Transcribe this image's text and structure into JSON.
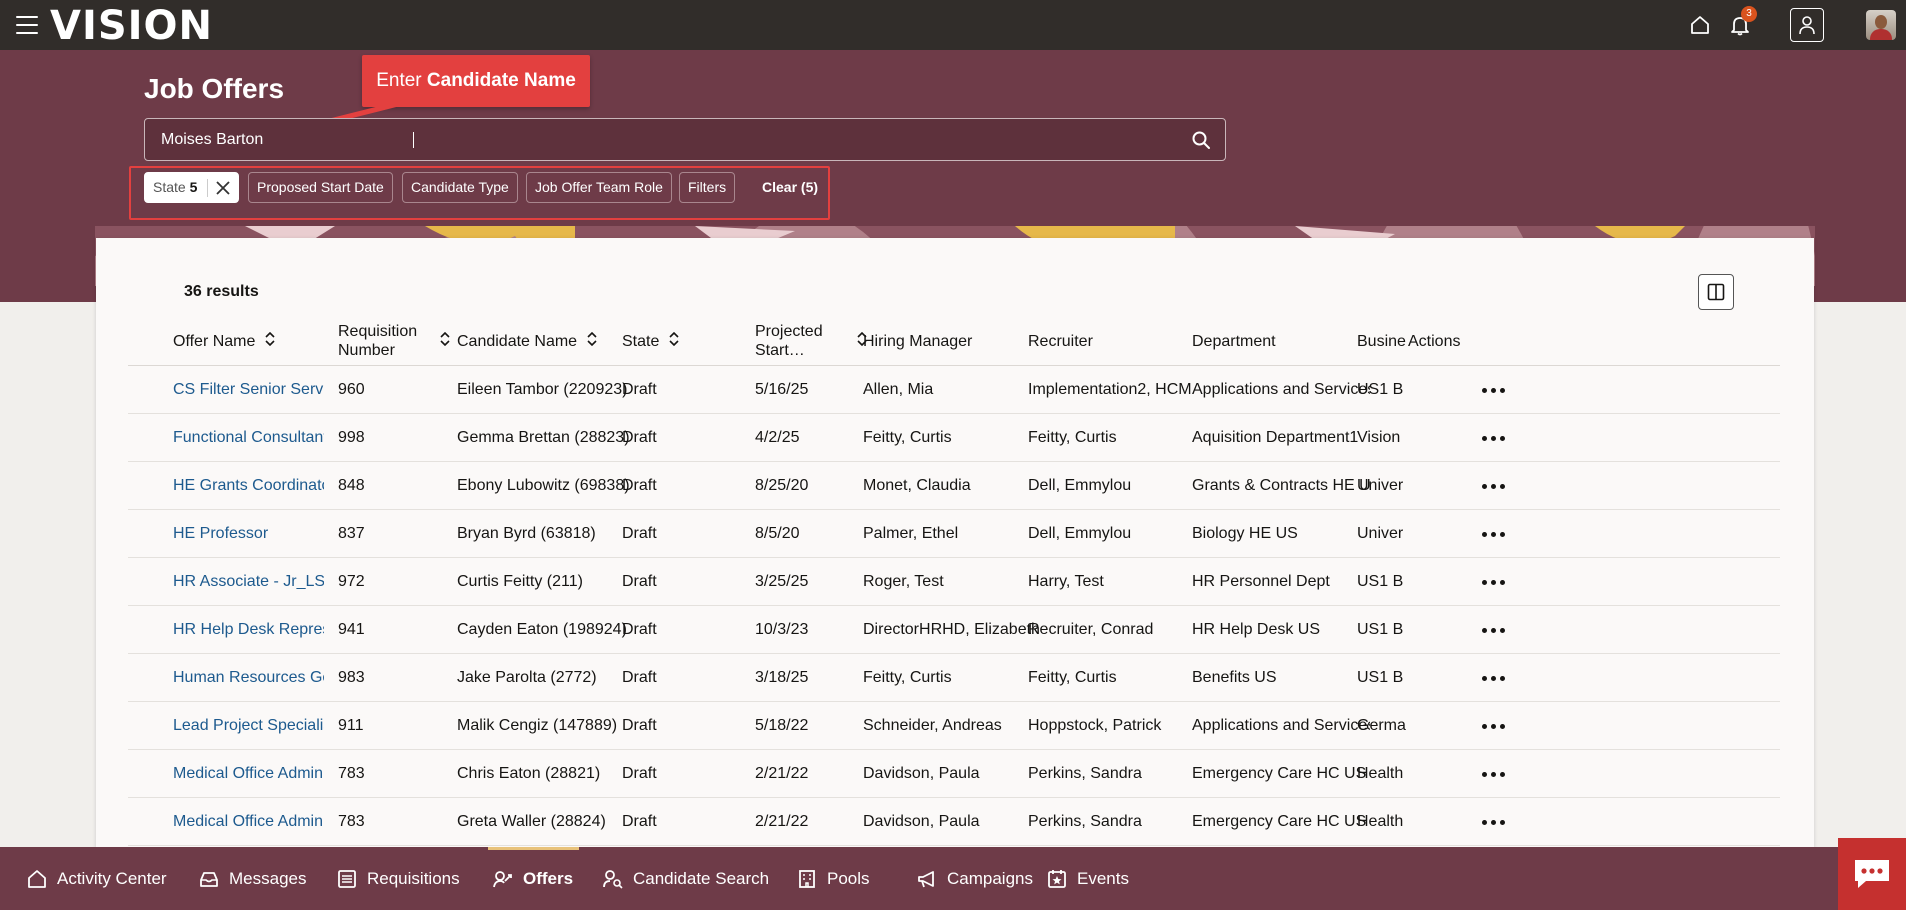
{
  "app": {
    "logo": "VISION",
    "notification_count": "3"
  },
  "page": {
    "title": "Job Offers"
  },
  "callout": {
    "prefix": "Enter ",
    "emphasis": "Candidate Name"
  },
  "search": {
    "value": "Moises Barton"
  },
  "filters": {
    "state_label": "State",
    "state_count": "5",
    "chips": [
      "Proposed Start Date",
      "Candidate Type",
      "Job Offer Team Role",
      "Filters"
    ],
    "clear_label": "Clear (5)"
  },
  "results": {
    "count_label": "36 results"
  },
  "table": {
    "columns": [
      "Offer Name",
      "Requisition Number",
      "Candidate Name",
      "State",
      "Projected Start…",
      "Hiring Manager",
      "Recruiter",
      "Department",
      "Busine",
      "Actions"
    ],
    "rows": [
      [
        "CS Filter Senior Service De",
        "960",
        "Eileen Tambor (220923)",
        "Draft",
        "5/16/25",
        "Allen, Mia",
        "Implementation2, HCM",
        "Applications and Services",
        "US1 B"
      ],
      [
        "Functional Consultant_Lc",
        "998",
        "Gemma Brettan (28823)",
        "Draft",
        "4/2/25",
        "Feitty, Curtis",
        "Feitty, Curtis",
        "Aquisition Department1",
        "Vision"
      ],
      [
        "HE Grants Coordinator",
        "848",
        "Ebony Lubowitz (69838)",
        "Draft",
        "8/25/20",
        "Monet, Claudia",
        "Dell, Emmylou",
        "Grants & Contracts HE US",
        "Univer"
      ],
      [
        "HE Professor",
        "837",
        "Bryan Byrd (63818)",
        "Draft",
        "8/5/20",
        "Palmer, Ethel",
        "Dell, Emmylou",
        "Biology HE US",
        "Univer"
      ],
      [
        "HR Associate - Jr_LS",
        "972",
        "Curtis Feitty (211)",
        "Draft",
        "3/25/25",
        "Roger, Test",
        "Harry, Test",
        "HR Personnel Dept",
        "US1 B"
      ],
      [
        "HR Help Desk Representa",
        "941",
        "Cayden Eaton (198924)",
        "Draft",
        "10/3/23",
        "DirectorHRHD, Elizabeth",
        "Recruiter, Conrad",
        "HR Help Desk US",
        "US1 B"
      ],
      [
        "Human Resources Genera",
        "983",
        "Jake Parolta (2772)",
        "Draft",
        "3/18/25",
        "Feitty, Curtis",
        "Feitty, Curtis",
        "Benefits US",
        "US1 B"
      ],
      [
        "Lead Project Specialist",
        "911",
        "Malik Cengiz (147889)",
        "Draft",
        "5/18/22",
        "Schneider, Andreas",
        "Hoppstock, Patrick",
        "Applications and Services",
        "Germa"
      ],
      [
        "Medical Office Administra",
        "783",
        "Chris Eaton (28821)",
        "Draft",
        "2/21/22",
        "Davidson, Paula",
        "Perkins, Sandra",
        "Emergency Care HC US",
        "Health"
      ],
      [
        "Medical Office Administra",
        "783",
        "Greta Waller (28824)",
        "Draft",
        "2/21/22",
        "Davidson, Paula",
        "Perkins, Sandra",
        "Emergency Care HC US",
        "Health"
      ]
    ]
  },
  "bottom_nav": [
    {
      "label": "Activity Center",
      "icon": "home-icon"
    },
    {
      "label": "Messages",
      "icon": "inbox-icon"
    },
    {
      "label": "Requisitions",
      "icon": "list-icon"
    },
    {
      "label": "Offers",
      "icon": "offers-icon",
      "active": true
    },
    {
      "label": "Candidate Search",
      "icon": "person-search-icon"
    },
    {
      "label": "Pools",
      "icon": "building-icon"
    },
    {
      "label": "Campaigns",
      "icon": "megaphone-icon"
    },
    {
      "label": "Events",
      "icon": "calendar-star-icon"
    }
  ],
  "colors": {
    "topbar": "#312d2a",
    "brand": "#6e3b48",
    "callout": "#e3403f",
    "link": "#1d5a8e",
    "active_nav": "#e8c27a"
  }
}
